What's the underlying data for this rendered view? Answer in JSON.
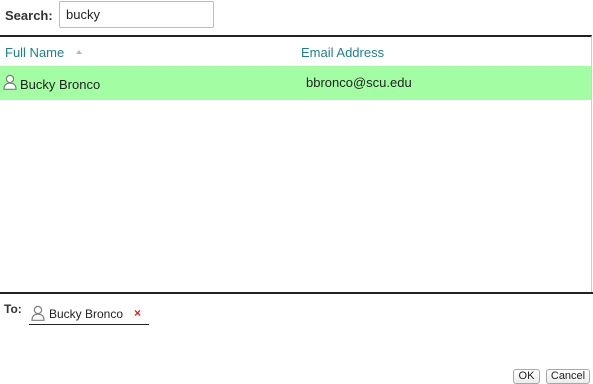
{
  "search": {
    "label": "Search:",
    "value": "bucky"
  },
  "results": {
    "columns": [
      {
        "label": "Full Name",
        "sorted": "ascending"
      },
      {
        "label": "Email Address"
      }
    ],
    "rows": [
      {
        "icon": "person-icon",
        "name": "Bucky Bronco",
        "email": "bbronco@scu.edu",
        "selected": true
      }
    ]
  },
  "to": {
    "label": "To:",
    "recipients": [
      {
        "icon": "person-icon",
        "name": "Bucky Bronco",
        "remove_glyph": "×"
      }
    ]
  },
  "buttons": {
    "ok": "OK",
    "cancel": "Cancel"
  },
  "colors": {
    "selected_row": "#a3fea3",
    "header_link": "#1f7f8c",
    "remove": "#e02020"
  }
}
